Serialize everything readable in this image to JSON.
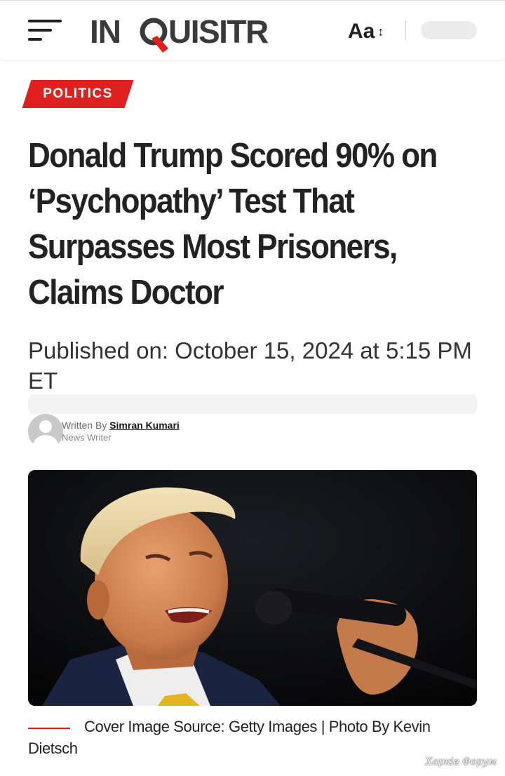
{
  "header": {
    "logo_text": "INQUISITR",
    "font_toggle_label": "Aa",
    "font_toggle_arrows": "↕"
  },
  "article": {
    "category": "POLITICS",
    "headline": "Donald Trump Scored 90% on ‘Psychopathy’ Test That Surpasses Most Prisoners, Claims Doctor",
    "published": "Published on: October 15, 2024 at 5:15 PM ET",
    "author_prefix": "Written By ",
    "author_name": "Simran Kumari",
    "author_role": "News Writer",
    "image_caption": "Cover Image Source: Getty Images | Photo By Kevin Dietsch"
  },
  "watermark": "Харків Форум",
  "colors": {
    "accent": "#e0201e",
    "text": "#222222",
    "background": "#ffffff"
  },
  "icons": {
    "menu": "hamburger-menu-icon",
    "font_size": "font-size-toggle-icon",
    "author_avatar": "user-avatar-placeholder-icon"
  }
}
